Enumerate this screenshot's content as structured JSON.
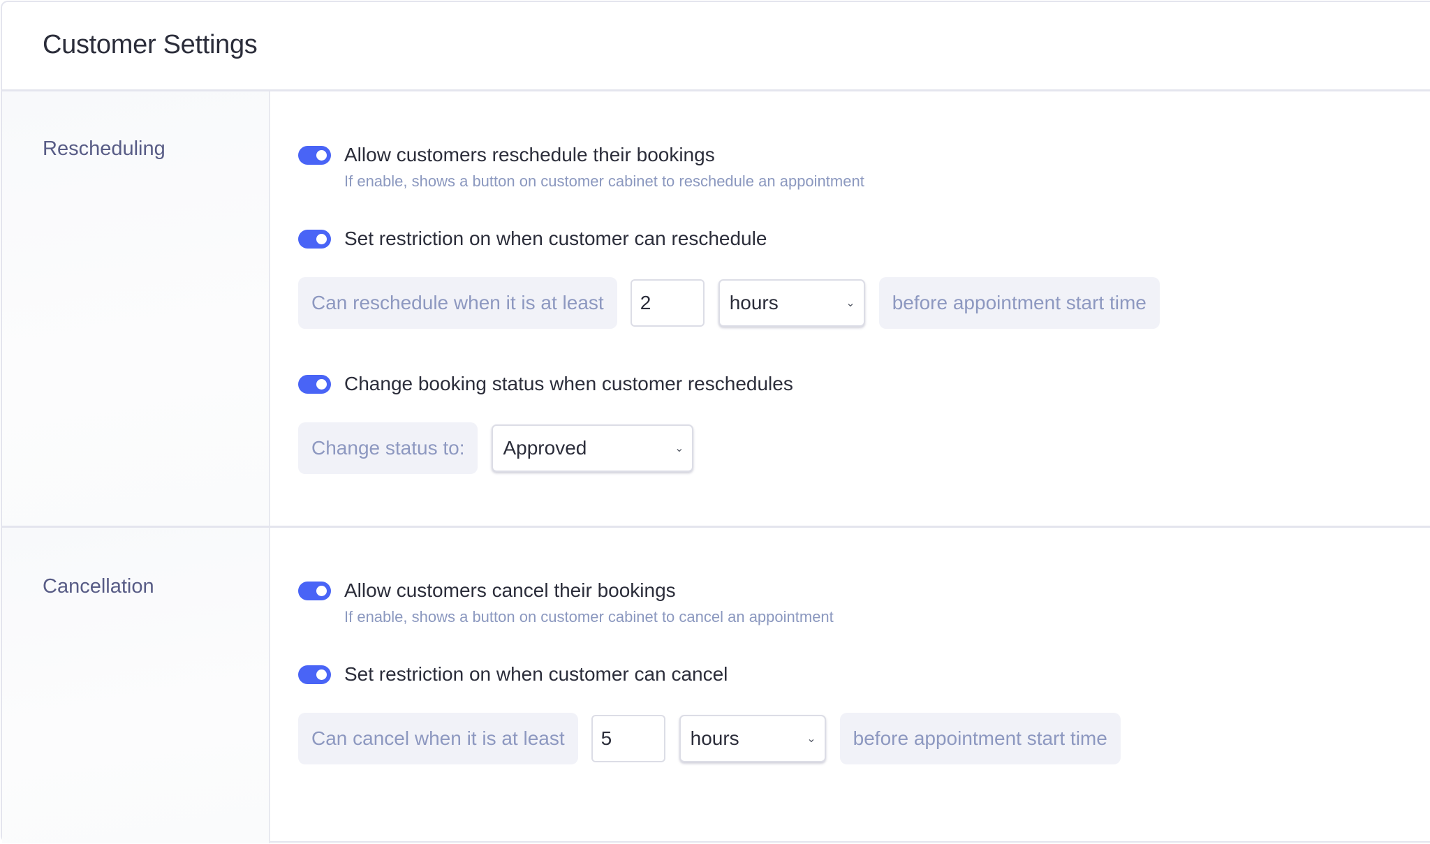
{
  "header": {
    "title": "Customer Settings"
  },
  "colors": {
    "accent": "#4964f6",
    "addon_bg": "#f1f2f8",
    "muted_text": "#8d98c0",
    "section_label": "#585c86"
  },
  "rescheduling": {
    "section_label": "Rescheduling",
    "allow_toggle": {
      "label": "Allow customers reschedule their bookings",
      "enabled": true,
      "description": "If enable, shows a button on customer cabinet to reschedule an appointment"
    },
    "restriction_toggle": {
      "label": "Set restriction on when customer can reschedule",
      "enabled": true
    },
    "restriction": {
      "prefix": "Can reschedule when it is at least",
      "value": "2",
      "unit": "hours",
      "suffix": "before appointment start time"
    },
    "status_toggle": {
      "label": "Change booking status when customer reschedules",
      "enabled": true
    },
    "status": {
      "prefix": "Change status to:",
      "value": "Approved"
    }
  },
  "cancellation": {
    "section_label": "Cancellation",
    "allow_toggle": {
      "label": "Allow customers cancel their bookings",
      "enabled": true,
      "description": "If enable, shows a button on customer cabinet to cancel an appointment"
    },
    "restriction_toggle": {
      "label": "Set restriction on when customer can cancel",
      "enabled": true
    },
    "restriction": {
      "prefix": "Can cancel when it is at least",
      "value": "5",
      "unit": "hours",
      "suffix": "before appointment start time"
    }
  },
  "icons": {
    "toggle": "toggle-switch-on",
    "select_arrow": "chevron-down-icon"
  }
}
